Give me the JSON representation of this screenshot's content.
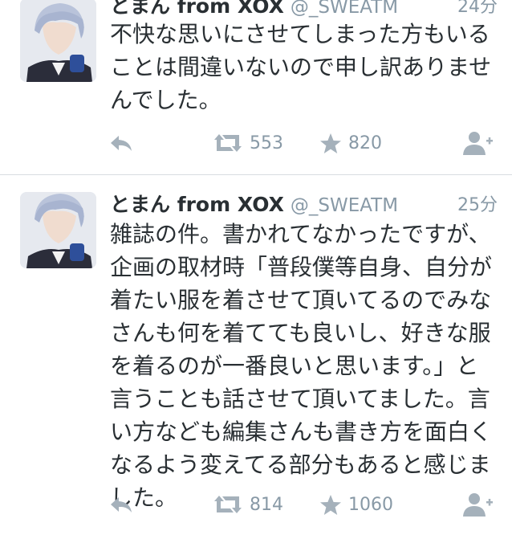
{
  "tweets": [
    {
      "name": "とまん from XOX",
      "handle": "@_SWEATM",
      "time": "24分",
      "text": "不快な思いにさせてしまった方もいる\nことは間違いないので申し訳ありませ\nんでした。",
      "retweets": "553",
      "favorites": "820"
    },
    {
      "name": "とまん from XOX",
      "handle": "@_SWEATM",
      "time": "25分",
      "text": "雑誌の件。書かれてなかったですが、\n企画の取材時「普段僕等自身、自分が\n着たい服を着させて頂いてるのでみな\nさんも何を着てても良いし、好きな服\nを着るのが一番良いと思います。」と\n言うことも話させて頂いてました。言\nい方なども編集さんも書き方を面白く\nなるよう変えてる部分もあると感じま\nした。",
      "retweets": "814",
      "favorites": "1060"
    }
  ],
  "icons": {
    "reply": "reply-icon",
    "retweet": "retweet-icon",
    "favorite": "star-icon",
    "follow": "follow-user-icon"
  },
  "colors": {
    "text": "#292f33",
    "secondary": "#8899a6",
    "icon": "#a5b1bb",
    "divider": "#d8dde1"
  }
}
